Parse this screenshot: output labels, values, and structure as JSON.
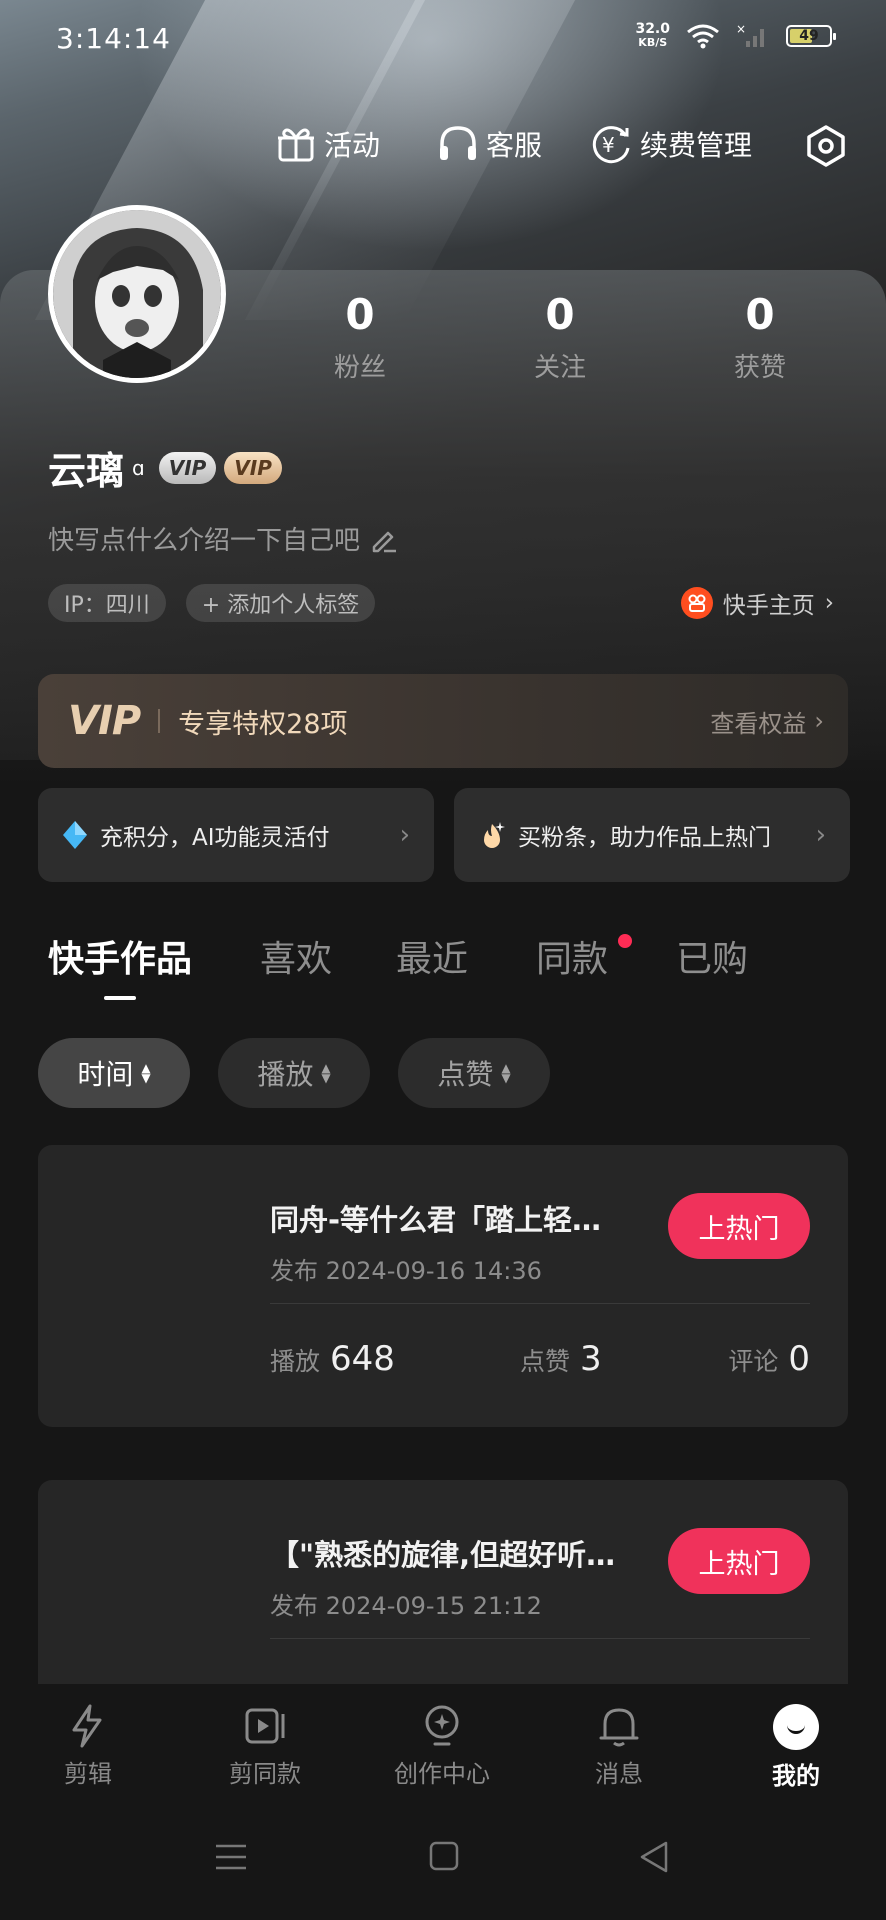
{
  "status_bar": {
    "time": "3:14:14",
    "net_speed": "32.0",
    "net_unit": "KB/S",
    "battery": "49"
  },
  "top_actions": {
    "activity": "活动",
    "service": "客服",
    "renew": "续费管理"
  },
  "profile": {
    "username": "云璃",
    "vip_badge_1": "VIP",
    "vip_badge_2": "VIP",
    "bio_placeholder": "快写点什么介绍一下自己吧",
    "ip_tag": "IP：四川",
    "add_tag": "+ 添加个人标签",
    "home_link": "快手主页",
    "stats": [
      {
        "value": "0",
        "label": "粉丝"
      },
      {
        "value": "0",
        "label": "关注"
      },
      {
        "value": "0",
        "label": "获赞"
      }
    ]
  },
  "vip_banner": {
    "logo": "VIP",
    "text": "专享特权28项",
    "view": "查看权益"
  },
  "promos": {
    "left": "充积分，AI功能灵活付",
    "right": "买粉条，助力作品上热门"
  },
  "tabs": [
    "快手作品",
    "喜欢",
    "最近",
    "同款",
    "已购"
  ],
  "sort": [
    "时间",
    "播放",
    "点赞"
  ],
  "works": [
    {
      "title": "同舟-等什么君「踏上轻舟去往白帝城」",
      "date": "发布 2024-09-16 14:36",
      "hot": "上热门",
      "play_label": "播放",
      "play": "648",
      "like_label": "点赞",
      "like": "3",
      "comment_label": "评论",
      "comment": "0"
    },
    {
      "title": "【\"熟悉的旋律,但超好听的翻唱",
      "date": "发布 2024-09-15 21:12",
      "hot": "上热门"
    }
  ],
  "bottom_nav": [
    "剪辑",
    "剪同款",
    "创作中心",
    "消息",
    "我的"
  ],
  "colors": {
    "accent": "#f0325b",
    "vip_gold": "#f1d9bb",
    "background": "#161616"
  }
}
